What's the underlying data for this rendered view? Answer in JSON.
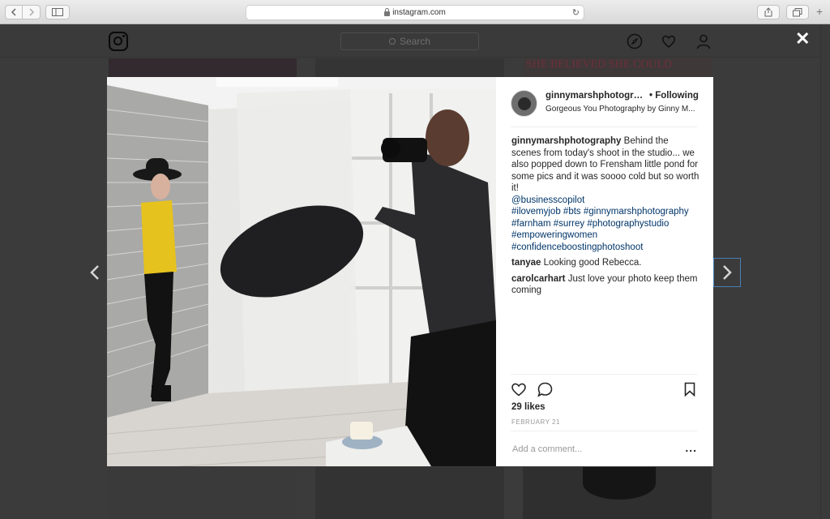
{
  "browser": {
    "url": "instagram.com",
    "back_icon": "chevron-left-icon",
    "forward_icon": "chevron-right-icon"
  },
  "ig_header": {
    "search_placeholder": "Search"
  },
  "background_banner_text": "SHE BELIEVED SHE COULD",
  "post": {
    "owner": "ginnymarshphotogra...",
    "follow_status": "• Following",
    "subtitle": "Gorgeous You Photography by Ginny M...",
    "caption_user": "ginnymarshphotography",
    "caption_text": "Behind the scenes from today's shoot in the studio... we also popped down to Frensham little pond for some pics and it was soooo cold but so worth it!",
    "mentions": [
      "@businesscopilot",
      "#ilovemyjob #bts #ginnymarshphotography",
      "#farnham #surrey #photographystudio",
      "#empoweringwomen",
      "#confidenceboostingphotoshoot"
    ],
    "comments": [
      {
        "user": "tanyae",
        "text": "Looking good Rebecca."
      },
      {
        "user": "carolcarhart",
        "text": "Just love your photo keep them coming"
      }
    ],
    "likes": "29 likes",
    "date": "FEBRUARY 21",
    "add_comment_placeholder": "Add a comment...",
    "more": "..."
  }
}
